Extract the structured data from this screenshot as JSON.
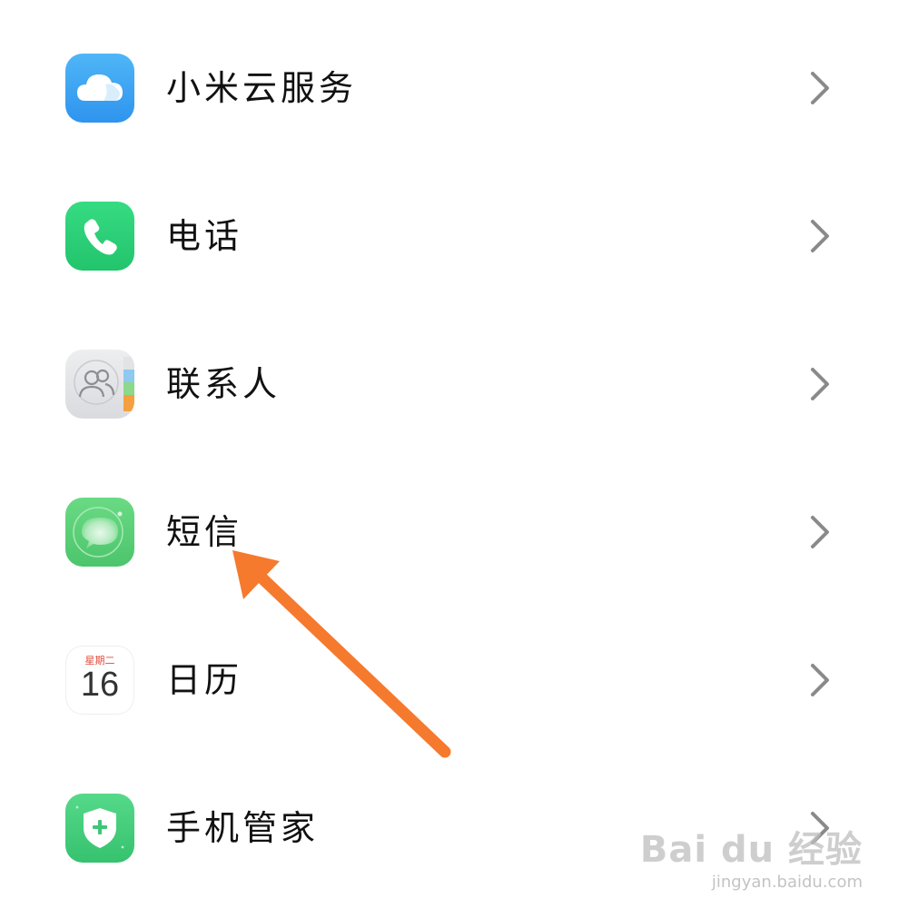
{
  "settings_list": {
    "items": [
      {
        "label": "小米云服务",
        "icon": "cloud-icon",
        "color": "#3DA8F5"
      },
      {
        "label": "电话",
        "icon": "phone-icon",
        "color": "#2ED47A"
      },
      {
        "label": "联系人",
        "icon": "contacts-icon",
        "color": "#E4E5E8"
      },
      {
        "label": "短信",
        "icon": "message-icon",
        "color": "#5FD37A"
      },
      {
        "label": "日历",
        "icon": "calendar-icon",
        "color": "#FFFFFF",
        "weekday": "星期二",
        "day": "16"
      },
      {
        "label": "手机管家",
        "icon": "security-shield-icon",
        "color": "#45D17C"
      }
    ]
  },
  "annotation": {
    "arrow_color": "#F57A2E",
    "target": "短信"
  },
  "watermark": {
    "brand": "Bai du 经验",
    "url": "jingyan.baidu.com"
  }
}
